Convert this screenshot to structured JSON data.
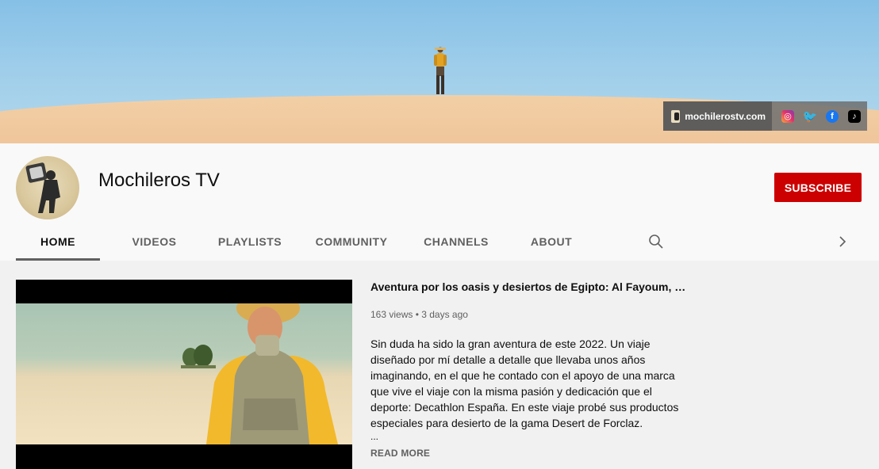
{
  "banner": {
    "website_label": "mochilerostv.com",
    "social_icons": [
      "instagram-icon",
      "twitter-icon",
      "facebook-icon",
      "tiktok-icon"
    ]
  },
  "channel": {
    "name": "Mochileros TV",
    "subscribe_label": "SUBSCRIBE",
    "subscribe_color": "#cc0000"
  },
  "tabs": [
    {
      "label": "HOME",
      "active": true
    },
    {
      "label": "VIDEOS",
      "active": false
    },
    {
      "label": "PLAYLISTS",
      "active": false
    },
    {
      "label": "COMMUNITY",
      "active": false
    },
    {
      "label": "CHANNELS",
      "active": false
    },
    {
      "label": "ABOUT",
      "active": false
    }
  ],
  "featured": {
    "title": "Aventura por los oasis y desiertos de Egipto: Al Fayoum, Desierto Blanco y Desierto Negro",
    "meta": "163 views • 3 days ago",
    "description": "Sin duda ha sido la gran aventura de este 2022. Un viaje diseñado por mí detalle a detalle que llevaba unos años imaginando, en el que he contado con el apoyo de una marca que vive el viaje con la misma pasión y dedicación que el deporte: Decathlon España. En este viaje probé sus productos especiales para desierto de la gama Desert de Forclaz.",
    "ellipsis": "...",
    "read_more": "READ MORE"
  }
}
